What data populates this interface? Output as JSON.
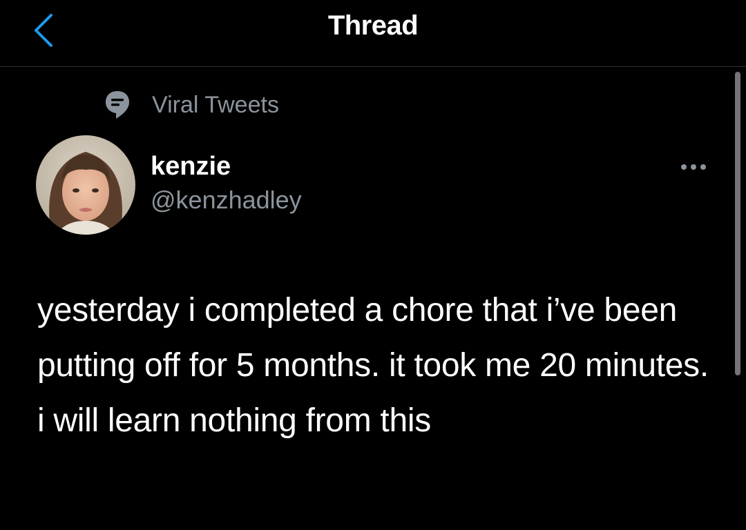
{
  "header": {
    "title": "Thread",
    "back_icon": "chevron-left-icon",
    "accent_color": "#1d9bf0"
  },
  "topic": {
    "label": "Viral Tweets",
    "icon": "speech-bubble-icon"
  },
  "tweet": {
    "author": {
      "display_name": "kenzie",
      "handle": "@kenzhadley",
      "avatar_icon": "avatar"
    },
    "more_icon": "more-options-icon",
    "text": "yesterday i completed a chore that i’ve been putting off for 5 months. it took me 20 minutes. i will learn nothing from this"
  },
  "colors": {
    "background": "#000000",
    "primary_text": "#ffffff",
    "secondary_text": "#8b949c",
    "divider": "#2f3336"
  }
}
